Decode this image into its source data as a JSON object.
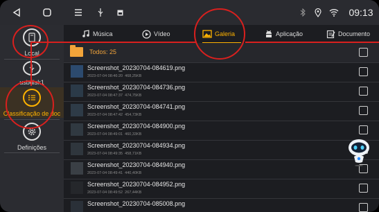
{
  "status_bar": {
    "time": "09:13",
    "icons": [
      "back-triangle-icon",
      "home-square-icon",
      "menu-lines-icon",
      "usb-icon",
      "image-small-icon",
      "bluetooth-icon",
      "location-icon",
      "wifi-icon"
    ]
  },
  "sidebar": {
    "items": [
      {
        "label": "Local",
        "icon": "disk-icon",
        "active": false
      },
      {
        "label": "usbdisk1",
        "icon": "usb-icon",
        "active": false
      },
      {
        "label": "Classificação de doc",
        "icon": "list-icon",
        "active": true
      },
      {
        "label": "Definições",
        "icon": "gear-icon",
        "active": false
      }
    ]
  },
  "tabs": [
    {
      "label": "Música",
      "icon": "music-note-icon",
      "active": false
    },
    {
      "label": "Vídeo",
      "icon": "play-icon",
      "active": false
    },
    {
      "label": "Galeria",
      "icon": "image-icon",
      "active": true
    },
    {
      "label": "Aplicação",
      "icon": "android-icon",
      "active": false
    },
    {
      "label": "Documento",
      "icon": "document-icon",
      "active": false
    }
  ],
  "list": {
    "all_label": "Todos: 25",
    "files": [
      {
        "name": "Screenshot_20230704-084619.png",
        "date": "2023-07-04 08:46:20",
        "size": "468,25KB"
      },
      {
        "name": "Screenshot_20230704-084736.png",
        "date": "2023-07-04 08:47:37",
        "size": "474,75KB"
      },
      {
        "name": "Screenshot_20230704-084741.png",
        "date": "2023-07-04 08:47:42",
        "size": "454,73KB"
      },
      {
        "name": "Screenshot_20230704-084900.png",
        "date": "2023-07-04 08:49:01",
        "size": "460,33KB"
      },
      {
        "name": "Screenshot_20230704-084934.png",
        "date": "2023-07-04 08:49:35",
        "size": "458,71KB"
      },
      {
        "name": "Screenshot_20230704-084940.png",
        "date": "2023-07-04 08:49:41",
        "size": "440,40KB"
      },
      {
        "name": "Screenshot_20230704-084952.png",
        "date": "2023-07-04 08:49:52",
        "size": "267,44KB"
      },
      {
        "name": "Screenshot_20230704-085008.png",
        "date": "",
        "size": ""
      }
    ]
  },
  "colors": {
    "accent": "#ffb300",
    "annotation": "#d9201e",
    "folder": "#f2a43a"
  }
}
